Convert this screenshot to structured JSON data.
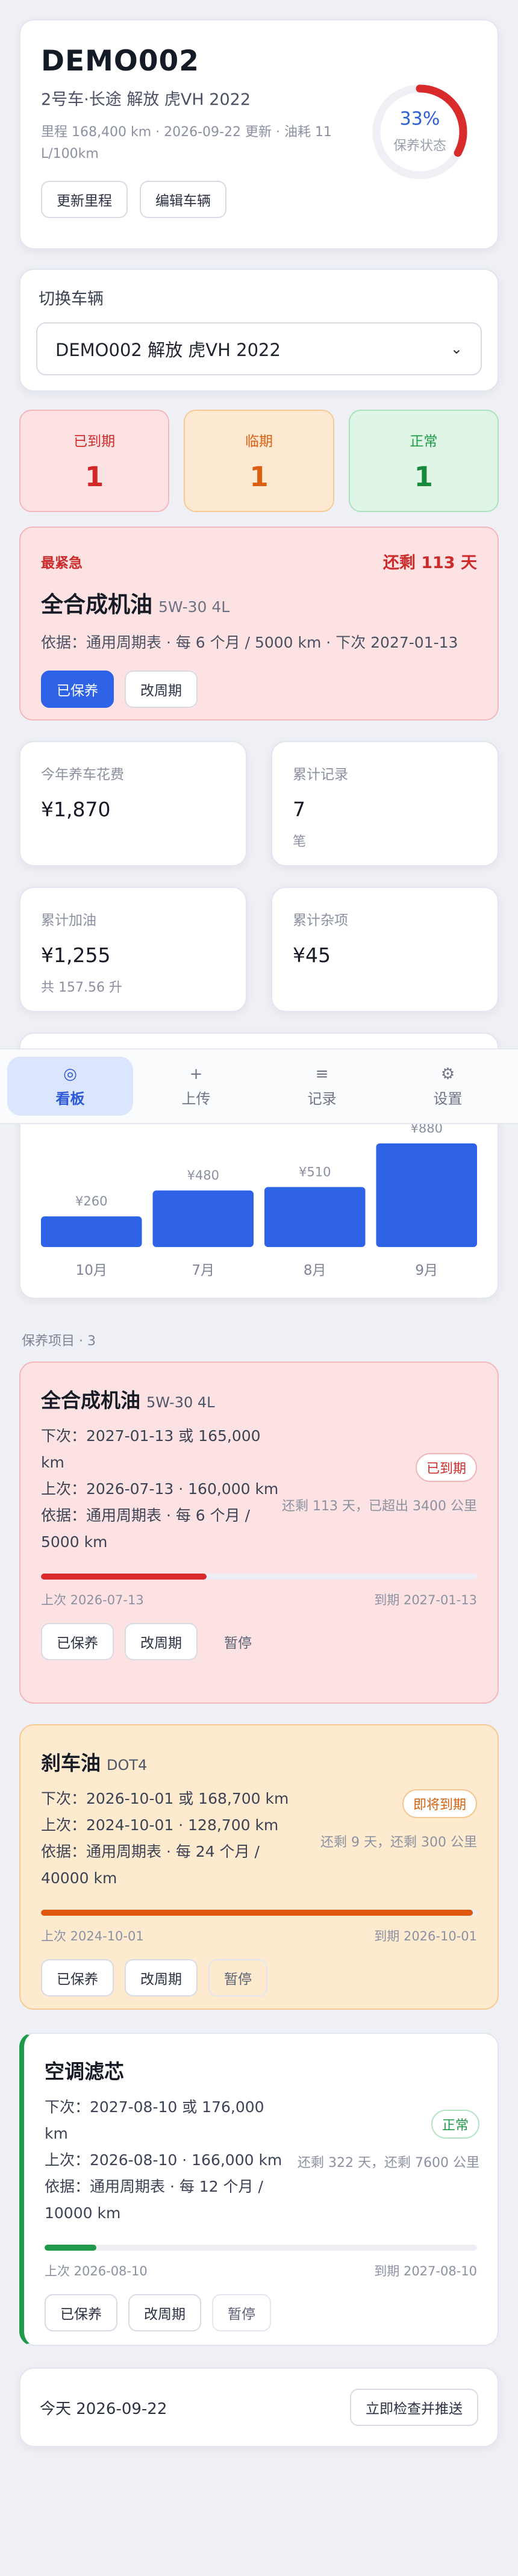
{
  "vehicle": {
    "plate": "DEMO002",
    "model": "2号车·长途 解放 虎VH 2022",
    "meta": "里程 168,400 km · 2026-09-22 更新 · 油耗 11 L/100km",
    "update_mileage_label": "更新里程",
    "edit_vehicle_label": "编辑车辆",
    "health_percent": 33,
    "health_percent_text": "33%",
    "health_label": "保养状态"
  },
  "switcher": {
    "title": "切换车辆",
    "selected": "DEMO002 解放 虎VH 2022"
  },
  "stats": {
    "overdue_label": "已到期",
    "overdue_count": "1",
    "due_soon_label": "临期",
    "due_soon_count": "1",
    "normal_label": "正常",
    "normal_count": "1"
  },
  "urgent": {
    "tag": "最紧急",
    "remaining": "还剩 113 天",
    "name": "全合成机油",
    "spec": "5W-30 4L",
    "basis": "依据：通用周期表 · 每 6 个月 / 5000 km · 下次 2027-01-13",
    "done_label": "已保养",
    "change_label": "改周期"
  },
  "summary": {
    "year_cost_label": "今年养车花费",
    "year_cost_value": "¥1,870",
    "records_label": "累计记录",
    "records_value": "7",
    "records_unit": "笔",
    "fuel_label": "累计加油",
    "fuel_value": "¥1,255",
    "fuel_sub": "共 157.56 升",
    "misc_label": "累计杂项",
    "misc_value": "¥45"
  },
  "chart_data": {
    "type": "bar",
    "categories": [
      "10月",
      "7月",
      "8月",
      "9月"
    ],
    "values": [
      260,
      480,
      510,
      880
    ],
    "data_labels": [
      "¥260",
      "¥480",
      "¥510",
      "¥880"
    ],
    "ylim": [
      0,
      880
    ],
    "grid": false,
    "colors": {
      "bar": "#2e63e8"
    }
  },
  "tabs": [
    {
      "icon": "◎",
      "label": "看板"
    },
    {
      "icon": "+",
      "label": "上传"
    },
    {
      "icon": "≡",
      "label": "记录"
    },
    {
      "icon": "⚙",
      "label": "设置"
    }
  ],
  "items_section": {
    "label": "保养项目 · 3"
  },
  "items": [
    {
      "name": "全合成机油",
      "spec": "5W-30 4L",
      "next": "下次：2027-01-13 或 165,000 km",
      "last": "上次：2026-07-13 · 160,000 km",
      "basis": "依据：通用周期表 · 每 6 个月 / 5000 km",
      "status": "已到期",
      "remain": "还剩 113 天，已超出 3400 公里",
      "progress": 0.38,
      "last_date": "上次 2026-07-13",
      "due_date": "到期 2027-01-13",
      "done_label": "已保养",
      "change_label": "改周期",
      "pause_label": "暂停"
    },
    {
      "name": "刹车油",
      "spec": "DOT4",
      "next": "下次：2026-10-01 或 168,700 km",
      "last": "上次：2024-10-01 · 128,700 km",
      "basis": "依据：通用周期表 · 每 24 个月 / 40000 km",
      "status": "即将到期",
      "remain": "还剩 9 天，还剩 300 公里",
      "progress": 0.99,
      "last_date": "上次 2024-10-01",
      "due_date": "到期 2026-10-01",
      "done_label": "已保养",
      "change_label": "改周期",
      "pause_label": "暂停"
    },
    {
      "name": "空调滤芯",
      "spec": "",
      "next": "下次：2027-08-10 或 176,000 km",
      "last": "上次：2026-08-10 · 166,000 km",
      "basis": "依据：通用周期表 · 每 12 个月 / 10000 km",
      "status": "正常",
      "remain": "还剩 322 天，还剩 7600 公里",
      "progress": 0.12,
      "last_date": "上次 2026-08-10",
      "due_date": "到期 2027-08-10",
      "done_label": "已保养",
      "change_label": "改周期",
      "pause_label": "暂停"
    }
  ],
  "footer": {
    "today": "今天 2026-09-22",
    "check_push_label": "立即检查并推送"
  },
  "colors": {
    "accent": "#2e63e8",
    "overdue": "#d32828",
    "due_soon": "#dc5f10",
    "normal": "#1d9a45"
  }
}
